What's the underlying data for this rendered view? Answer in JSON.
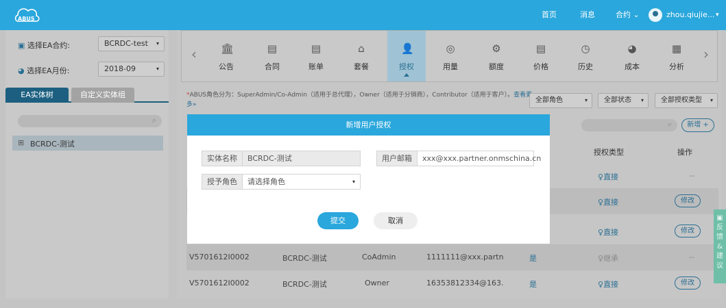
{
  "header": {
    "logo_text": "ABUS",
    "nav": [
      "首页",
      "消息",
      "合约 ⌄"
    ],
    "user": "zhou.qiujie...",
    "user_caret": "▾"
  },
  "sidebar": {
    "contract_label": "选择EA合约:",
    "contract_value": "BCRDC-test",
    "month_label": "选择EA月份:",
    "month_value": "2018-09",
    "caret": "▾",
    "tabs": [
      "EA实体树",
      "自定义实体组"
    ],
    "tree_item": "BCRDC-测试",
    "tree_toggle": "⊞"
  },
  "toolbar": {
    "prev": "‹",
    "next": "›",
    "items": [
      {
        "label": "公告",
        "icon": "🏛"
      },
      {
        "label": "合同",
        "icon": "▤"
      },
      {
        "label": "账单",
        "icon": "▤"
      },
      {
        "label": "套餐",
        "icon": "⌂"
      },
      {
        "label": "授权",
        "icon": "👤"
      },
      {
        "label": "用量",
        "icon": "◎"
      },
      {
        "label": "额度",
        "icon": "⚙"
      },
      {
        "label": "价格",
        "icon": "▤"
      },
      {
        "label": "历史",
        "icon": "◷"
      },
      {
        "label": "成本",
        "icon": "◕"
      },
      {
        "label": "分析",
        "icon": "▦"
      }
    ]
  },
  "note": {
    "star": "*",
    "text": "ABUS角色分为：SuperAdmin/Co-Admin（适用于总代理），Owner（适用于分销商），Contributor（适用于客户）。",
    "more": "查看更多»"
  },
  "filters": [
    "全部角色",
    "全部状态",
    "全部授权类型"
  ],
  "filter_caret": "▾",
  "grid": {
    "search_icon": "⌕",
    "add_label": "新增 +",
    "headers": [
      "授权类型",
      "操作"
    ],
    "rows": [
      {
        "id": "",
        "entity": "",
        "role": "",
        "email": "",
        "flag": "",
        "type": "直接",
        "op": "--"
      },
      {
        "id": "",
        "entity": "",
        "role": "",
        "email": "",
        "flag": "",
        "type": "直接",
        "op": "修改"
      },
      {
        "id": "",
        "entity": "",
        "role": "",
        "email": "",
        "flag": "",
        "type": "直接",
        "op": "修改"
      },
      {
        "id": "V5701612I0002",
        "entity": "BCRDC-测试",
        "role": "CoAdmin",
        "email": "1111111@xxx.partn",
        "flag": "是",
        "type": "继承",
        "op": "--"
      },
      {
        "id": "V5701612I0002",
        "entity": "BCRDC-测试",
        "role": "Owner",
        "email": "16353812334@163.",
        "flag": "是",
        "type": "直接",
        "op": "修改"
      }
    ],
    "user_icon": "♀"
  },
  "feedback": [
    "反",
    "馈",
    "&",
    "建",
    "议"
  ],
  "modal": {
    "title": "新增用户授权",
    "entity_label": "实体名称",
    "entity_value": "BCRDC-测试",
    "email_label": "用户邮箱",
    "email_value": "xxx@xxx.partner.onmschina.cn",
    "role_label": "授予角色",
    "role_placeholder": "请选择角色",
    "submit": "提交",
    "cancel": "取消"
  }
}
